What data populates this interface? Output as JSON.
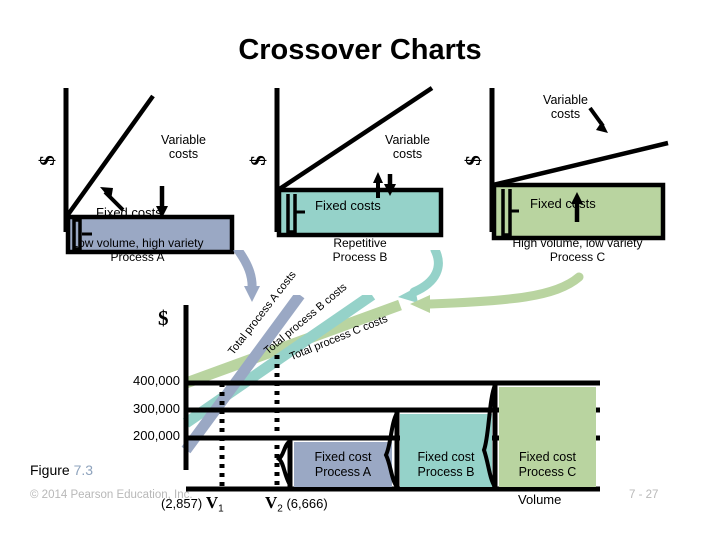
{
  "slide": {
    "title": "Crossover Charts",
    "figure_prefix": "Figure ",
    "figure_number": "7.3",
    "copyright": "© 2014 Pearson Education, Inc.",
    "page_number": "7 - 27"
  },
  "colors": {
    "process_a": "#9aa8c4",
    "process_b": "#95d2c9",
    "process_c": "#b9d4a0",
    "line": "#000000",
    "figure_number": "#8ea3bd",
    "footer_text": "#b8b8b8"
  },
  "top_charts": [
    {
      "id": "a",
      "axis_label": "$",
      "variable_label": "Variable\ncosts",
      "variable_label_line1": "Variable",
      "variable_label_line2": "costs",
      "fixed_label": "Fixed costs",
      "caption_line1": "Low volume, high variety",
      "caption_line2": "Process A",
      "fill": "#9aa8c4",
      "slope_steepness": "steep"
    },
    {
      "id": "b",
      "axis_label": "$",
      "variable_label_line1": "Variable",
      "variable_label_line2": "costs",
      "fixed_label": "Fixed costs",
      "caption_line1": "Repetitive",
      "caption_line2": "Process B",
      "fill": "#95d2c9",
      "slope_steepness": "medium"
    },
    {
      "id": "c",
      "axis_label": "$",
      "variable_label_line1": "Variable",
      "variable_label_line2": "costs",
      "fixed_label": "Fixed costs",
      "caption_line1": "High volume, low variety",
      "caption_line2": "Process C",
      "fill": "#b9d4a0",
      "slope_steepness": "shallow"
    }
  ],
  "chart_data": {
    "type": "line",
    "title": "Crossover Charts",
    "xlabel": "Volume",
    "ylabel": "$",
    "ytick_labels": [
      "200,000",
      "300,000",
      "400,000"
    ],
    "ytick_values": [
      200000,
      300000,
      400000
    ],
    "ylim": [
      0,
      470000
    ],
    "xlim": [
      0,
      10000
    ],
    "grid": false,
    "crossover_points": [
      {
        "label": "V",
        "subscript": "1",
        "value_text": "(2,857)",
        "value": 2857
      },
      {
        "label": "V",
        "subscript": "2",
        "value_text": "(6,666)",
        "value": 6666
      }
    ],
    "series": [
      {
        "name": "Total process A costs",
        "color": "#9aa8c4",
        "fixed_cost": 200000,
        "annotation": "Total process A costs"
      },
      {
        "name": "Total process B costs",
        "color": "#95d2c9",
        "fixed_cost": 300000,
        "annotation": "Total process B costs"
      },
      {
        "name": "Total process C costs",
        "color": "#b9d4a0",
        "fixed_cost": 400000,
        "annotation": "Total process C costs"
      }
    ],
    "fixed_cost_boxes": [
      {
        "line1": "Fixed cost",
        "line2": "Process A",
        "fill": "#9aa8c4",
        "amount": 200000
      },
      {
        "line1": "Fixed cost",
        "line2": "Process B",
        "fill": "#95d2c9",
        "amount": 300000
      },
      {
        "line1": "Fixed cost",
        "line2": "Process C",
        "fill": "#b9d4a0",
        "amount": 400000
      }
    ]
  }
}
